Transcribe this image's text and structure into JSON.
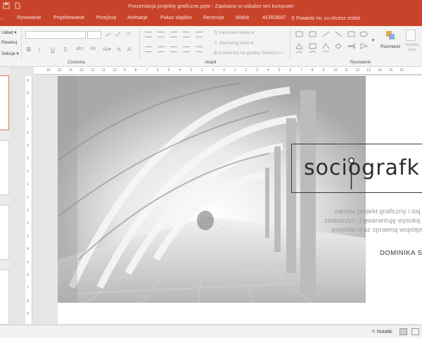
{
  "window": {
    "title": "Prezentacja projekty graficzne.pptx  -  Zapisano w usłudze ten komputer"
  },
  "tabs": [
    {
      "label": "Rysowanie"
    },
    {
      "label": "Projektowanie"
    },
    {
      "label": "Przejścia"
    },
    {
      "label": "Animacje"
    },
    {
      "label": "Pokaz slajdów"
    },
    {
      "label": "Recenzja"
    },
    {
      "label": "Widok"
    },
    {
      "label": "ACROBAT"
    }
  ],
  "search": {
    "placeholder": "Powiedz mi, co chcesz zrobić"
  },
  "ribbon": {
    "slides_group": {
      "layout": "Układ",
      "reset": "Resetuj",
      "section": "Sekcja"
    },
    "text_group": {
      "text_direction": "Kierunek tekstu",
      "align_text": "Wyrównaj tekst",
      "convert_smartart": "Konwertuj na grafikę SmartArt"
    },
    "format_buttons": [
      "B",
      "I",
      "U",
      "S"
    ],
    "arrange_label": "Rozmieść",
    "quick_styles_label": "Szybkie style",
    "groups": {
      "font": "Czcionka",
      "paragraph": "Akapit",
      "drawing": "Rysowanie"
    }
  },
  "ruler": {
    "h_ticks": [
      "16",
      "15",
      "14",
      "13",
      "12",
      "11",
      "10",
      "9",
      "8",
      "7",
      "6",
      "5",
      "4",
      "3",
      "2",
      "1",
      "0",
      "1",
      "2",
      "3",
      "4",
      "5",
      "6",
      "7",
      "8",
      "9",
      "10",
      "11",
      "12",
      "13",
      "14",
      "15",
      "16"
    ],
    "v_ticks": [
      "9",
      "8",
      "7",
      "6",
      "5",
      "4",
      "3",
      "2",
      "1",
      "0",
      "1",
      "2",
      "3",
      "4",
      "5",
      "6",
      "7",
      "8",
      "9"
    ]
  },
  "slide": {
    "logo": "sociografk",
    "tagline": [
      "zamów projekt graficzny i daj się",
      "zaskoczyć:-) gwarantuję wysoką jakość",
      "projektu oraz sprawną współpracę"
    ],
    "author": "DOMINIKA S"
  },
  "statusbar": {
    "notes": "Notatki"
  },
  "colors": {
    "accent": "#c9432a"
  }
}
